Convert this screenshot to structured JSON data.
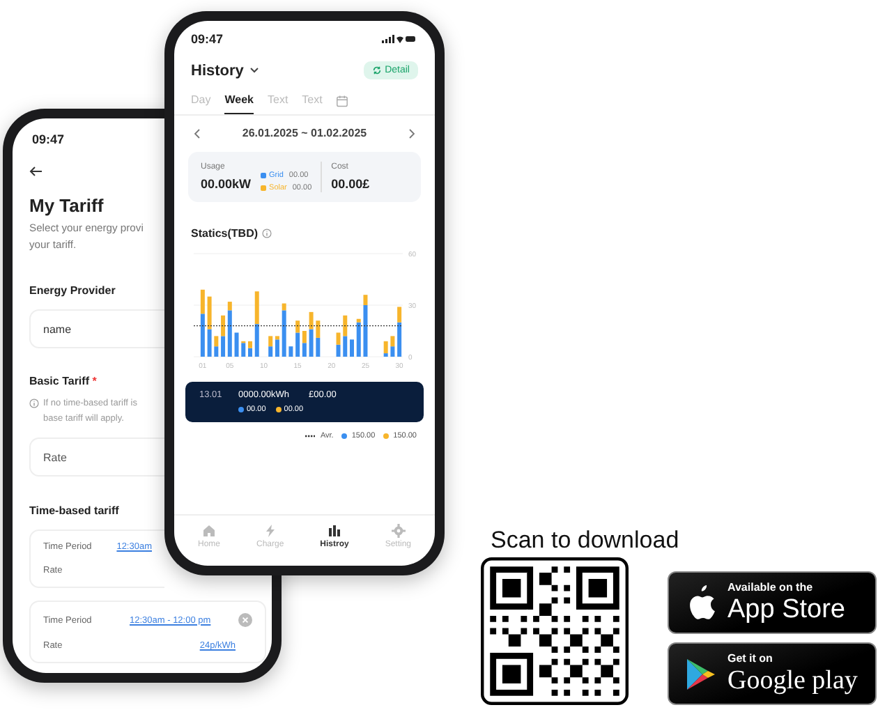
{
  "back_phone": {
    "status_time": "09:47",
    "title": "My Tariff",
    "subtitle_lines": [
      "Select your energy provi",
      "your tariff."
    ],
    "provider": {
      "label": "Energy Provider",
      "value": "name"
    },
    "basic_tariff": {
      "label": "Basic Tariff",
      "required_mark": "*",
      "info_lines": [
        "If no time-based tariff is",
        "base tariff will apply."
      ],
      "placeholder": "Rate"
    },
    "time_tariff": {
      "label": "Time-based tariff",
      "periods": [
        {
          "period_label": "Time Period",
          "period": "12:30am",
          "rate_label": "Rate"
        },
        {
          "period_label": "Time Period",
          "period": "12:30am - 12:00 pm",
          "rate_label": "Rate",
          "rate": "24p/kWh"
        }
      ]
    }
  },
  "front_phone": {
    "status_time": "09:47",
    "title": "History",
    "detail_button": "Detail",
    "tabs": [
      {
        "label": "Day",
        "selected": false
      },
      {
        "label": "Week",
        "selected": true
      },
      {
        "label": "Text",
        "selected": false
      },
      {
        "label": "Text",
        "selected": false
      }
    ],
    "date_range": "26.01.2025 ~ 01.02.2025",
    "usage": {
      "label": "Usage",
      "value": "00.00kW",
      "grid_value": "00.00",
      "solar_value": "00.00"
    },
    "cost": {
      "label": "Cost",
      "value": "00.00£"
    },
    "statics_title": "Statics(TBD)",
    "chart_data": {
      "type": "bar",
      "stacked": true,
      "x": [
        1,
        2,
        3,
        4,
        5,
        6,
        7,
        8,
        9,
        10,
        11,
        12,
        13,
        14,
        15,
        16,
        17,
        18,
        19,
        20,
        21,
        22,
        23,
        24,
        25,
        26,
        27,
        28,
        29,
        30
      ],
      "xticks": [
        {
          "value": 1,
          "label": "01"
        },
        {
          "value": 5,
          "label": "05"
        },
        {
          "value": 10,
          "label": "10"
        },
        {
          "value": 15,
          "label": "15"
        },
        {
          "value": 20,
          "label": "20"
        },
        {
          "value": 25,
          "label": "25"
        },
        {
          "value": 30,
          "label": "30"
        }
      ],
      "xlim": [
        0.5,
        30.5
      ],
      "ylim": [
        0,
        60
      ],
      "yticks": [
        0,
        30,
        60
      ],
      "series": [
        {
          "name": "Grid",
          "color": "#3b8ff0",
          "values": [
            25,
            16,
            6,
            12,
            27,
            14,
            8,
            5,
            19,
            null,
            6,
            10,
            27,
            6,
            14,
            8,
            16,
            11,
            null,
            null,
            7,
            12,
            10,
            20,
            30,
            null,
            null,
            2,
            6,
            20
          ]
        },
        {
          "name": "Solar",
          "color": "#f7b52c",
          "values": [
            14,
            19,
            6,
            12,
            5,
            0,
            1,
            4,
            19,
            null,
            6,
            2,
            4,
            0,
            7,
            7,
            10,
            10,
            null,
            null,
            7,
            12,
            0,
            2,
            6,
            null,
            null,
            7,
            6,
            9
          ]
        }
      ],
      "ref_lines": [
        {
          "axis": "y",
          "value": 18
        }
      ]
    },
    "tooltip": {
      "date": "13.01",
      "energy": "0000.00kWh",
      "cost": "£00.00",
      "grid": "00.00",
      "solar": "00.00"
    },
    "legend": {
      "avg_label": "Avr.",
      "grid": "150.00",
      "solar": "150.00"
    },
    "nav": [
      {
        "label": "Home",
        "kind": "home",
        "selected": false
      },
      {
        "label": "Charge",
        "kind": "charge",
        "selected": false
      },
      {
        "label": "Histroy",
        "kind": "history",
        "selected": true
      },
      {
        "label": "Setting",
        "kind": "setting",
        "selected": false
      }
    ]
  },
  "download": {
    "title": "Scan to download",
    "app_store": {
      "small": "Available on the",
      "big": "App Store"
    },
    "google_play": {
      "small": "Get it on",
      "big": "Google play"
    }
  }
}
